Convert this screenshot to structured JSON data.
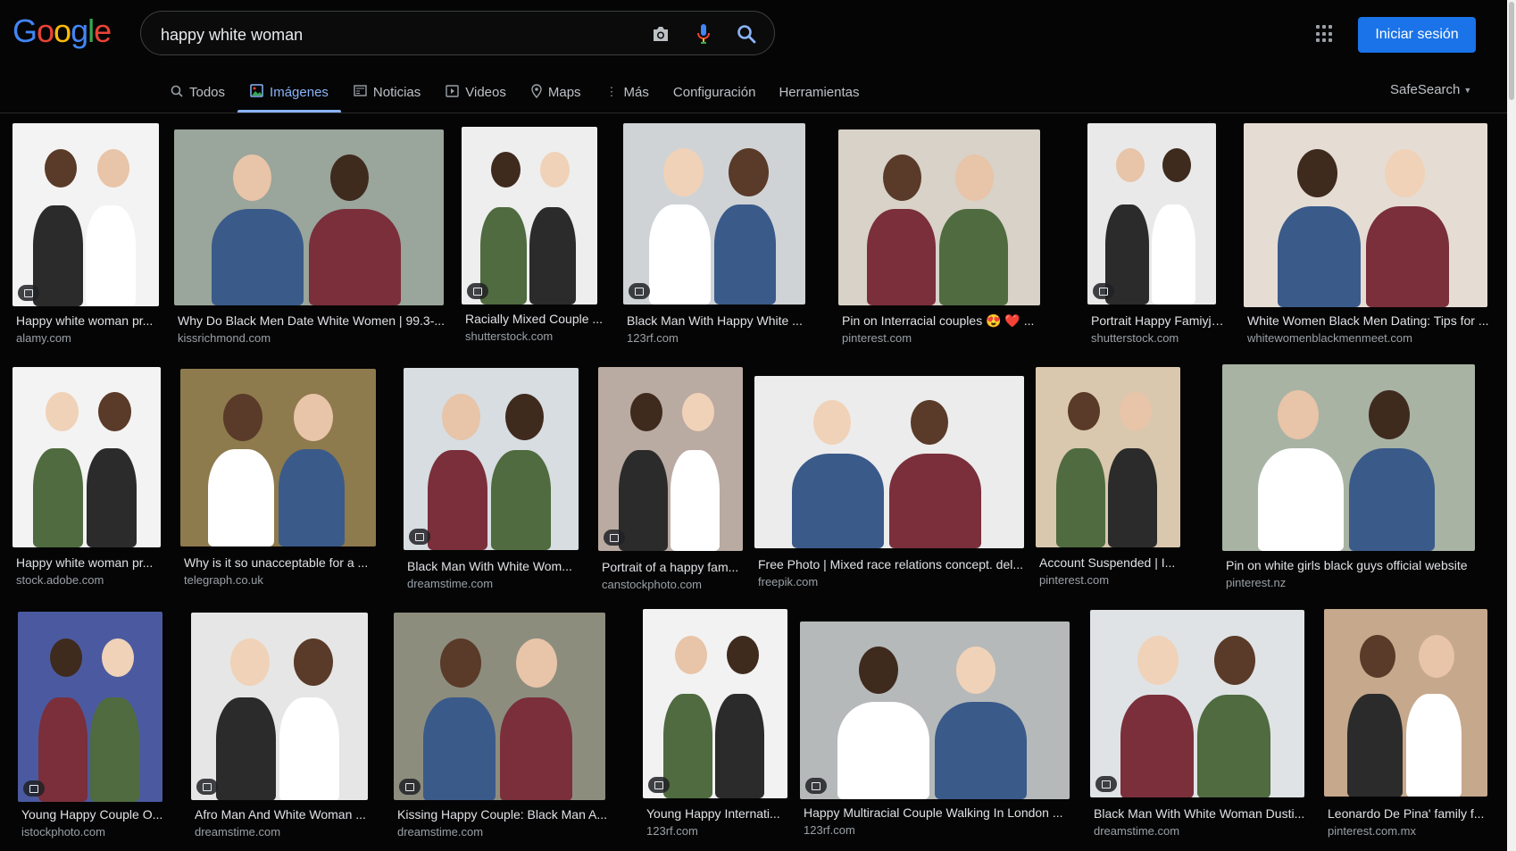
{
  "logo": {
    "letters": [
      "G",
      "o",
      "o",
      "g",
      "l",
      "e"
    ],
    "colors": [
      "#4285f4",
      "#ea4335",
      "#fbbc05",
      "#4285f4",
      "#34a853",
      "#ea4335"
    ]
  },
  "search": {
    "query": "happy white woman"
  },
  "header": {
    "signin_label": "Iniciar sesión"
  },
  "tabs": [
    {
      "label": "Todos",
      "icon": "search-icon"
    },
    {
      "label": "Imágenes",
      "icon": "image-icon",
      "active": true
    },
    {
      "label": "Noticias",
      "icon": "news-icon"
    },
    {
      "label": "Videos",
      "icon": "play-icon"
    },
    {
      "label": "Maps",
      "icon": "map-pin-icon"
    },
    {
      "label": "Más",
      "icon": "more-vert-icon"
    },
    {
      "label": "Configuración"
    },
    {
      "label": "Herramientas"
    }
  ],
  "safesearch_label": "SafeSearch",
  "results": [
    {
      "title": "Happy white woman pr...",
      "source": "alamy.com",
      "badge": true,
      "photo_bg": "#f3f3f3"
    },
    {
      "title": "Why Do Black Men Date White Women | 99.3-...",
      "source": "kissrichmond.com",
      "badge": false,
      "photo_bg": "#9aa59b"
    },
    {
      "title": "Racially Mixed Couple ...",
      "source": "shutterstock.com",
      "badge": true,
      "photo_bg": "#eeeeee"
    },
    {
      "title": "Black Man With Happy White ...",
      "source": "123rf.com",
      "badge": true,
      "photo_bg": "#cfd3d6"
    },
    {
      "title": "Pin on Interracial couples 😍 ❤️ ...",
      "source": "pinterest.com",
      "badge": false,
      "photo_bg": "#d8d2c8"
    },
    {
      "title": "Portrait Happy Famiyj ...",
      "source": "shutterstock.com",
      "badge": true,
      "photo_bg": "#e9e9e9"
    },
    {
      "title": "White Women Black Men Dating: Tips for ...",
      "source": "whitewomenblackmenmeet.com",
      "badge": false,
      "photo_bg": "#e5ddd4"
    },
    {
      "title": "Happy white woman pr...",
      "source": "stock.adobe.com",
      "badge": false,
      "photo_bg": "#f3f3f3"
    },
    {
      "title": "Why is it so unacceptable for a ...",
      "source": "telegraph.co.uk",
      "badge": false,
      "photo_bg": "#8d7a4d"
    },
    {
      "title": "Black Man With White Wom...",
      "source": "dreamstime.com",
      "badge": true,
      "photo_bg": "#d7dde1"
    },
    {
      "title": "Portrait of a happy fam...",
      "source": "canstockphoto.com",
      "badge": true,
      "photo_bg": "#b9aaa2"
    },
    {
      "title": "Free Photo | Mixed race relations concept. del...",
      "source": "freepik.com",
      "badge": false,
      "photo_bg": "#ececec"
    },
    {
      "title": "Account Suspended | I...",
      "source": "pinterest.com",
      "badge": false,
      "photo_bg": "#d9c8ae"
    },
    {
      "title": "Pin on white girls black guys official website",
      "source": "pinterest.nz",
      "badge": false,
      "photo_bg": "#a8b3a4"
    },
    {
      "title": "Young Happy Couple O...",
      "source": "istockphoto.com",
      "badge": true,
      "photo_bg": "#4b5aa0"
    },
    {
      "title": "Afro Man And White Woman ...",
      "source": "dreamstime.com",
      "badge": true,
      "photo_bg": "#e6e6e6"
    },
    {
      "title": "Kissing Happy Couple: Black Man A...",
      "source": "dreamstime.com",
      "badge": true,
      "photo_bg": "#8d8d7e"
    },
    {
      "title": "Young Happy Internati...",
      "source": "123rf.com",
      "badge": true,
      "photo_bg": "#f2f2f2"
    },
    {
      "title": "Happy Multiracial Couple Walking In London ...",
      "source": "123rf.com",
      "badge": true,
      "photo_bg": "#b5b9ba"
    },
    {
      "title": "Black Man With White Woman Dusti...",
      "source": "dreamstime.com",
      "badge": true,
      "photo_bg": "#dfe3e6"
    },
    {
      "title": "Leonardo De Pina' family f...",
      "source": "pinterest.com.mx",
      "badge": false,
      "photo_bg": "#c6a88c"
    }
  ]
}
